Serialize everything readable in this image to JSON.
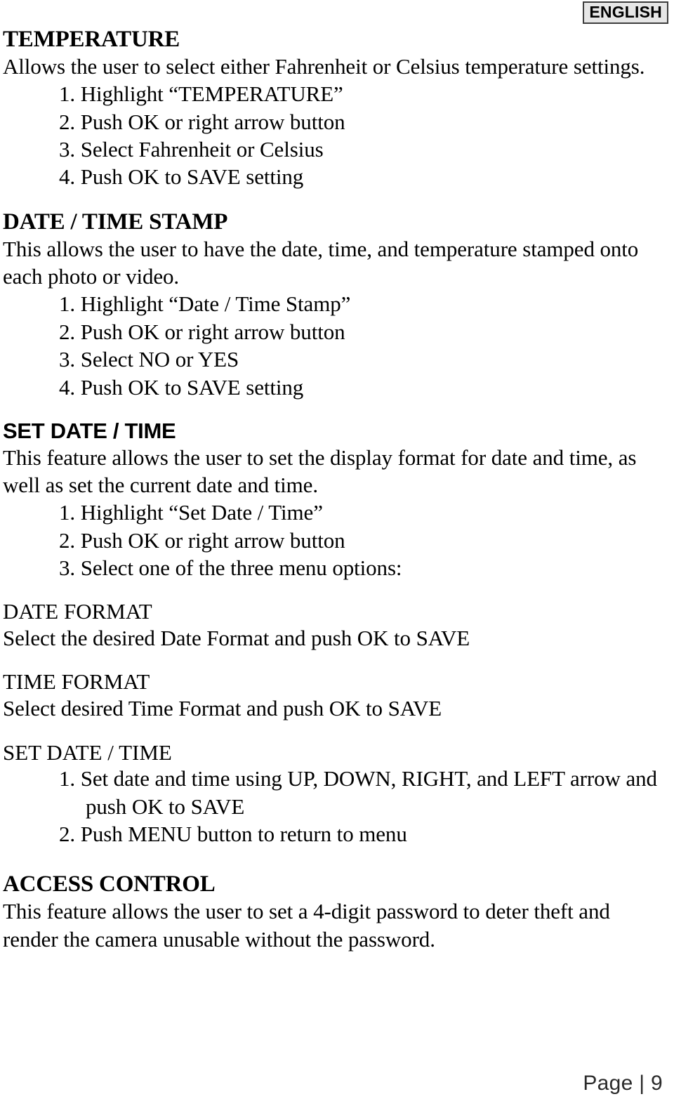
{
  "header": {
    "language_badge": "ENGLISH"
  },
  "sections": [
    {
      "heading": "TEMPERATURE",
      "heading_style": "bold-serif",
      "body": "Allows the user to select either Fahrenheit or Celsius temperature settings.",
      "steps": [
        "1. Highlight “TEMPERATURE”",
        "2. Push OK or right arrow button",
        "3. Select Fahrenheit or Celsius",
        "4. Push OK to SAVE setting"
      ]
    },
    {
      "heading": "DATE / TIME STAMP",
      "heading_style": "bold-serif",
      "body": "This allows the user to have the date, time, and temperature stamped onto each photo or video.",
      "steps": [
        "1. Highlight “Date / Time Stamp”",
        "2. Push OK or right arrow button",
        "3. Select NO or YES",
        "4. Push OK to SAVE setting"
      ]
    },
    {
      "heading": "SET DATE / TIME",
      "heading_style": "bold-sans",
      "body": "This feature allows the user to set the display format for date and time, as well as set the current date and time.",
      "steps": [
        "1. Highlight “Set Date / Time”",
        "2. Push OK or right arrow button",
        "3. Select one of the three menu options:"
      ]
    }
  ],
  "menu_options": [
    {
      "heading": "DATE FORMAT",
      "body": "Select the desired Date Format and push OK to SAVE"
    },
    {
      "heading": "TIME FORMAT",
      "body": "Select desired Time Format and push OK to SAVE"
    },
    {
      "heading": "SET DATE / TIME",
      "steps": [
        "1. Set date and time using UP, DOWN, RIGHT, and LEFT arrow and push OK to SAVE",
        "2. Push MENU button to return to menu"
      ]
    }
  ],
  "access_control": {
    "heading": "ACCESS CONTROL",
    "body": "This feature allows the user to set a 4-digit password to deter theft and render the camera unusable without the password."
  },
  "footer": {
    "page_label": "Page | 9"
  }
}
